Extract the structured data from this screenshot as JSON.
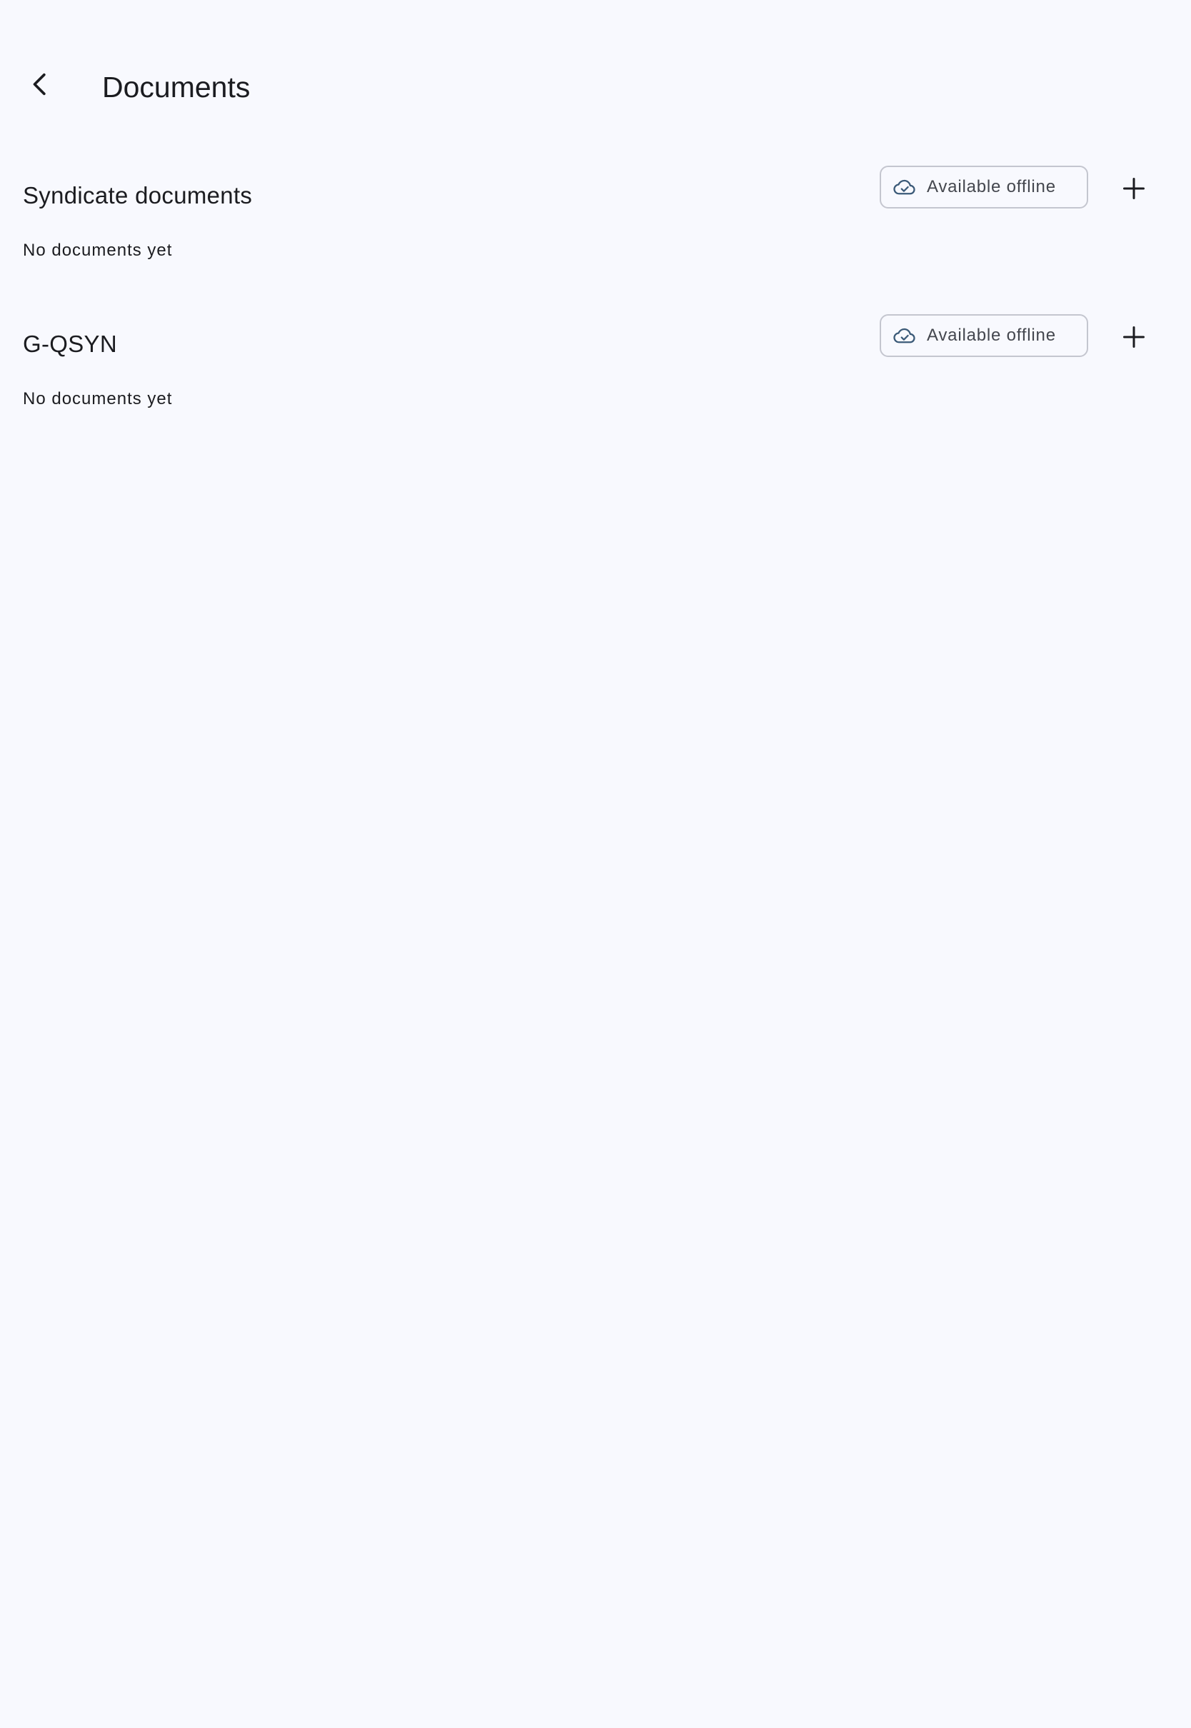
{
  "app_bar": {
    "title": "Documents",
    "back_icon": "chevron-left-icon"
  },
  "sections": [
    {
      "title": "Syndicate documents",
      "offline_chip": {
        "label": "Available offline",
        "icon": "cloud-check-icon"
      },
      "add_icon": "plus-icon",
      "empty_text": "No documents yet"
    },
    {
      "title": "G-QSYN",
      "offline_chip": {
        "label": "Available offline",
        "icon": "cloud-check-icon"
      },
      "add_icon": "plus-icon",
      "empty_text": "No documents yet"
    }
  ],
  "colors": {
    "background": "#f8f9fe",
    "text": "#1b1c20",
    "chip_border": "#c4c6cf",
    "icon_accent": "#3b5a78"
  }
}
